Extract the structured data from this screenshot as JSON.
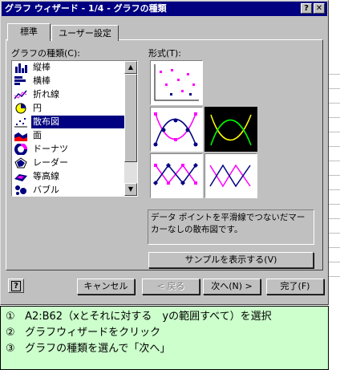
{
  "dialog": {
    "title": "グラフ ウィザード - 1/4 - グラフの種類",
    "help_glyph": "?",
    "close_glyph": "✕",
    "tabs": [
      {
        "label": "標準",
        "active": true
      },
      {
        "label": "ユーザー設定",
        "active": false
      }
    ],
    "chart_type_label": "グラフの種類(C):",
    "chart_types": [
      {
        "label": "縦棒",
        "icon": "column-chart-icon"
      },
      {
        "label": "横棒",
        "icon": "bar-chart-icon"
      },
      {
        "label": "折れ線",
        "icon": "line-chart-icon"
      },
      {
        "label": "円",
        "icon": "pie-chart-icon"
      },
      {
        "label": "散布図",
        "icon": "scatter-chart-icon",
        "selected": true
      },
      {
        "label": "面",
        "icon": "area-chart-icon"
      },
      {
        "label": "ドーナツ",
        "icon": "doughnut-chart-icon"
      },
      {
        "label": "レーダー",
        "icon": "radar-chart-icon"
      },
      {
        "label": "等高線",
        "icon": "surface-chart-icon"
      },
      {
        "label": "バブル",
        "icon": "bubble-chart-icon"
      }
    ],
    "subtype_label": "形式(T):",
    "subtypes": [
      {
        "name": "scatter-markers-only"
      },
      {
        "name": "scatter-smoothed-lines-markers"
      },
      {
        "name": "scatter-smoothed-lines-no-markers",
        "selected": true
      },
      {
        "name": "scatter-straight-lines-markers"
      },
      {
        "name": "scatter-straight-lines-no-markers"
      }
    ],
    "description": "データ ポイントを平滑線でつないだマーカーなしの散布図です。",
    "sample_button": "サンプルを表示する(V)",
    "help_button": "?",
    "cancel_button": "キャンセル",
    "back_button": "< 戻る",
    "next_button": "次へ(N) >",
    "finish_button": "完了(F)",
    "colors": {
      "title_bar": "#000080",
      "face": "#c0c0c0",
      "selection": "#000080",
      "marker": "#ff00ff",
      "curve": "#000080",
      "selected_curve": "#ffff00"
    }
  },
  "instructions": [
    {
      "num": "①",
      "text": "A2:B62（xとそれに対する　yの範囲すべて）を選択"
    },
    {
      "num": "②",
      "text": "グラフウィザードをクリック"
    },
    {
      "num": "③",
      "text": "グラフの種類を選んで「次へ」"
    }
  ]
}
